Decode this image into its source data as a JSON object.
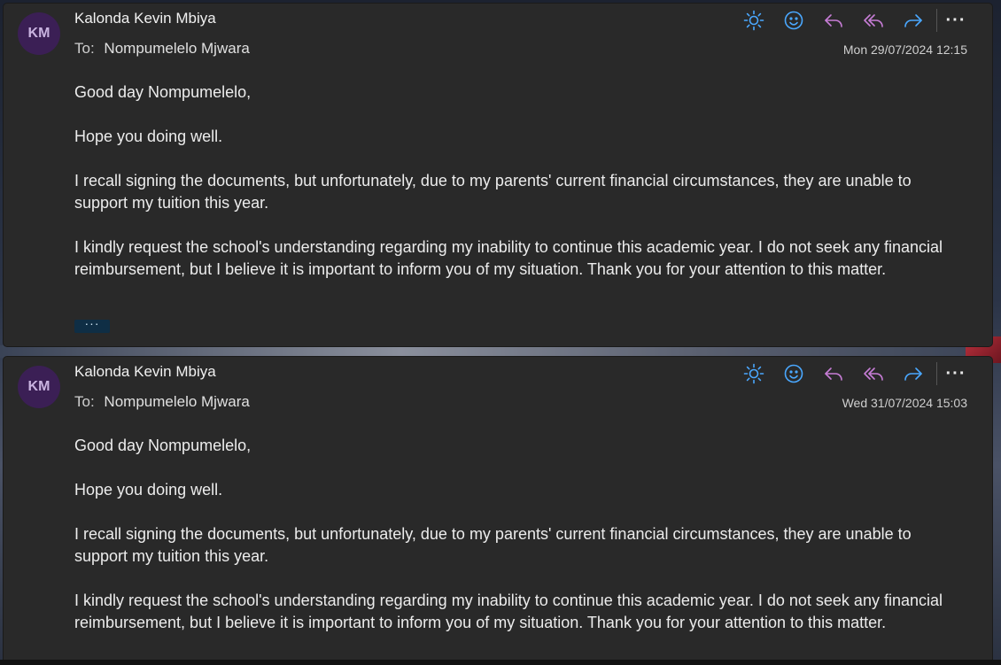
{
  "messages": [
    {
      "avatar_initials": "KM",
      "sender": "Kalonda Kevin Mbiya",
      "to_label": "To:",
      "recipient": "Nompumelelo Mjwara",
      "date": "Mon 29/07/2024 12:15",
      "paragraphs": [
        "Good day Nompumelelo,",
        "Hope you doing well.",
        "I recall signing the documents, but unfortunately, due to my parents' current financial circumstances, they are unable to support my tuition this year.",
        "I kindly request the school's understanding regarding my inability to continue this academic year. I do not seek any financial reimbursement, but I believe it is important to inform you of my situation. Thank you for your attention to this matter."
      ],
      "show_trimmed_label": "···"
    },
    {
      "avatar_initials": "KM",
      "sender": "Kalonda Kevin Mbiya",
      "to_label": "To:",
      "recipient": "Nompumelelo Mjwara",
      "date": "Wed 31/07/2024 15:03",
      "paragraphs": [
        "Good day Nompumelelo,",
        "Hope you doing well.",
        "I recall signing the documents, but unfortunately, due to my parents' current financial circumstances, they are unable to support my tuition this year.",
        "I kindly request the school's understanding regarding my inability to continue this academic year. I do not seek any financial reimbursement, but I believe it is important to inform you of my situation. Thank you for your attention to this matter."
      ]
    }
  ],
  "toolbar": {
    "icons": [
      "sun-icon",
      "emoji-icon",
      "reply-icon",
      "reply-all-icon",
      "forward-icon",
      "more-icon"
    ],
    "more_label": "···"
  },
  "colors": {
    "accent_blue": "#4aa8ff",
    "reply_purple": "#c77dd6",
    "avatar_bg": "#3b1f55",
    "card_bg": "#292929"
  }
}
